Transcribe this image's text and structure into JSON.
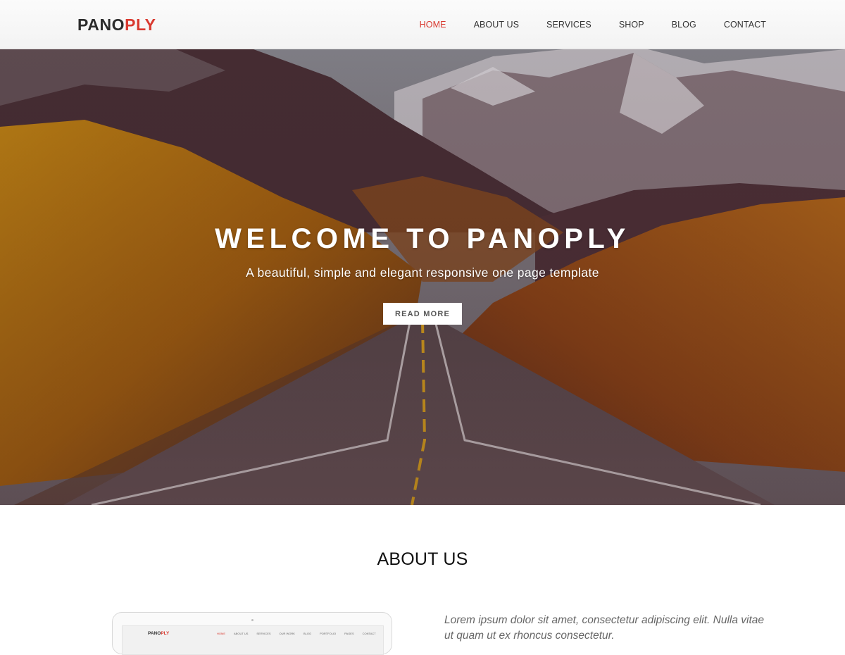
{
  "brand": {
    "logo_main": "PANO",
    "logo_accent": "PLY",
    "accent_color": "#d9392f"
  },
  "nav": {
    "items": [
      {
        "label": "HOME",
        "active": true
      },
      {
        "label": "ABOUT US",
        "active": false
      },
      {
        "label": "SERVICES",
        "active": false
      },
      {
        "label": "SHOP",
        "active": false
      },
      {
        "label": "BLOG",
        "active": false
      },
      {
        "label": "CONTACT",
        "active": false
      }
    ]
  },
  "hero": {
    "title": "WELCOME TO PANOPLY",
    "subtitle": "A beautiful, simple and elegant responsive one page template",
    "button_label": "READ MORE"
  },
  "about": {
    "heading": "ABOUT US",
    "text": "Lorem ipsum dolor sit amet, consectetur adipiscing elit. Nulla vitae ut quam ut ex rhoncus consectetur.",
    "preview": {
      "logo_main": "PANO",
      "logo_accent": "PLY",
      "nav": [
        "HOME",
        "ABOUT US",
        "SERVICES",
        "OUR WORK",
        "BLOG",
        "PORTFOLIO",
        "PAGES",
        "CONTACT"
      ]
    }
  }
}
